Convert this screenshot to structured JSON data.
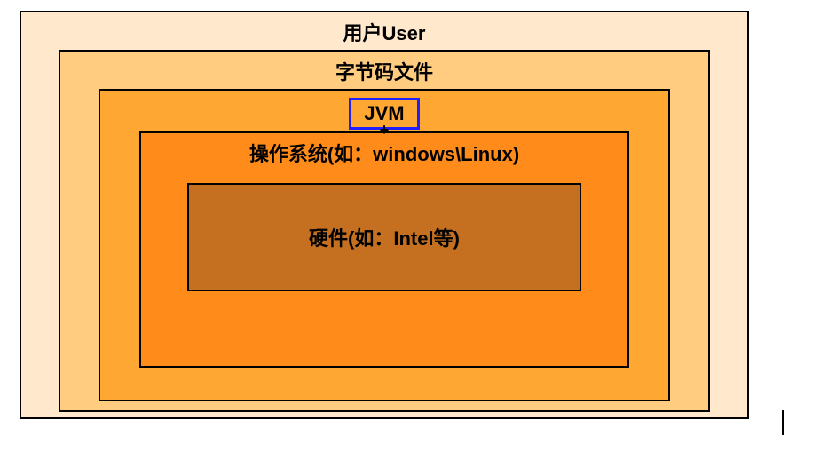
{
  "layers": {
    "user": "用户User",
    "bytecode": "字节码文件",
    "jvm": "JVM",
    "os": "操作系统(如：windows\\Linux)",
    "hardware": "硬件(如：Intel等)"
  },
  "plus": "+"
}
